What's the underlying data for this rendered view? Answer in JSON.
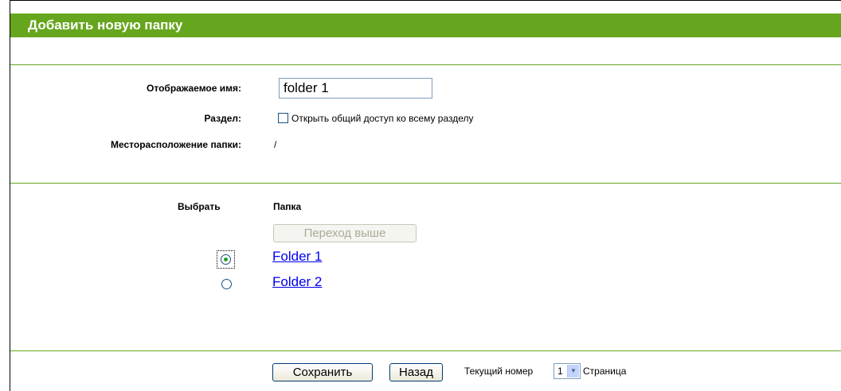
{
  "header": {
    "title": "Добавить новую папку"
  },
  "form": {
    "display_name_label": "Отображаемое имя:",
    "display_name_value": "folder 1",
    "partition_label": "Раздел:",
    "share_partition_label": "Открыть общий доступ ко всему разделу",
    "share_partition_checked": false,
    "folder_location_label": "Месторасположение папки:",
    "folder_location_value": "/"
  },
  "folder_list": {
    "select_header": "Выбрать",
    "folder_header": "Папка",
    "go_up_label": "Переход выше",
    "go_up_enabled": false,
    "items": [
      {
        "name": "Folder 1",
        "selected": true
      },
      {
        "name": "Folder 2",
        "selected": false
      }
    ]
  },
  "footer": {
    "save_label": "Сохранить",
    "back_label": "Назад",
    "current_page_label": "Текущий номер",
    "page_value": "1",
    "page_suffix": "Страница"
  },
  "colors": {
    "header_green": "#66a61e",
    "link_blue": "#0000ee",
    "radio_green": "#21a121"
  }
}
